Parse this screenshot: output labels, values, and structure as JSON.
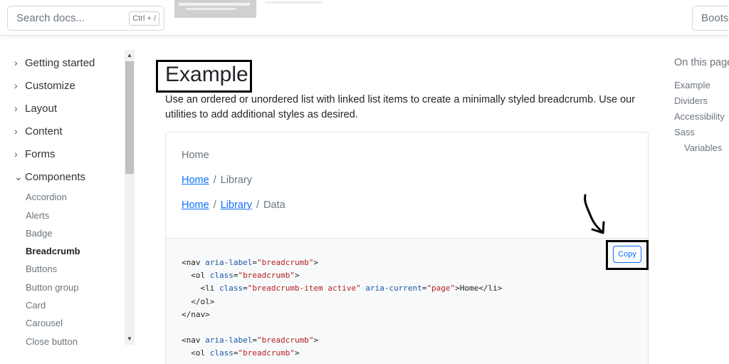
{
  "topbar": {
    "search_placeholder": "Search docs...",
    "search_shortcut": "Ctrl + /",
    "version_label": "Boots"
  },
  "sidebar": {
    "sections": [
      {
        "label": "Getting started",
        "expanded": false
      },
      {
        "label": "Customize",
        "expanded": false
      },
      {
        "label": "Layout",
        "expanded": false
      },
      {
        "label": "Content",
        "expanded": false
      },
      {
        "label": "Forms",
        "expanded": false
      },
      {
        "label": "Components",
        "expanded": true
      }
    ],
    "components": [
      "Accordion",
      "Alerts",
      "Badge",
      "Breadcrumb",
      "Buttons",
      "Button group",
      "Card",
      "Carousel",
      "Close button"
    ],
    "active_item": "Breadcrumb"
  },
  "main": {
    "heading": "Example",
    "intro": "Use an ordered or unordered list with linked list items to create a minimally styled breadcrumb. Use our utilities to add additional styles as desired.",
    "example": {
      "row1": {
        "active": "Home"
      },
      "row2": {
        "link": "Home",
        "sep": "/",
        "active": "Library"
      },
      "row3": {
        "link1": "Home",
        "link2": "Library",
        "sep": "/",
        "active": "Data"
      }
    },
    "copy_label": "Copy"
  },
  "toc": {
    "title": "On this page",
    "items": [
      "Example",
      "Dividers",
      "Accessibility",
      "Sass",
      "Variables"
    ]
  },
  "colors": {
    "link": "#0d6efd",
    "muted": "#6c757d",
    "code_attr": "#1a55a7",
    "code_string": "#b22222"
  }
}
